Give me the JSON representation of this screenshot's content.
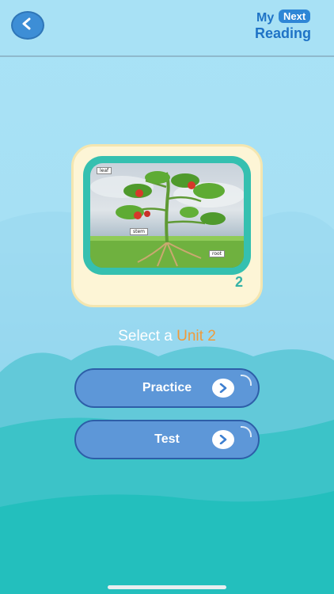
{
  "header": {
    "back_icon": "back-chevron-icon",
    "logo": {
      "my": "My",
      "next": "Next",
      "reading": "Reading"
    }
  },
  "card": {
    "image_labels": {
      "leaf": "leaf",
      "stem": "stem",
      "root": "root"
    },
    "unit_number": "2"
  },
  "prompt": {
    "prefix": "Select a",
    "unit": "Unit 2"
  },
  "buttons": [
    {
      "label": "Practice",
      "icon": "arrow-right-icon"
    },
    {
      "label": "Test",
      "icon": "arrow-right-icon"
    }
  ],
  "colors": {
    "accent": "#f09a3a",
    "button": "#5d97d8",
    "frame": "#35c0b0"
  }
}
